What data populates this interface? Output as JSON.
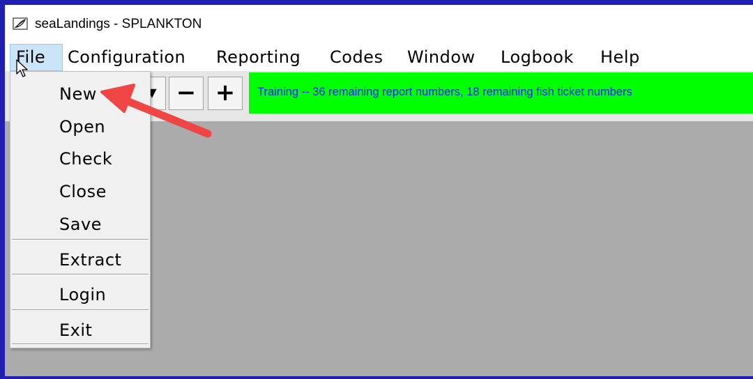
{
  "window": {
    "title": "seaLandings - SPLANKTON",
    "icon": "app-feather-icon"
  },
  "menubar": {
    "items": [
      "File",
      "Configuration",
      "Reporting",
      "Codes",
      "Window",
      "Logbook",
      "Help"
    ],
    "active": "File"
  },
  "toolbar": {
    "buttons": [
      {
        "name": "dropdown-arrow",
        "label": "▾"
      },
      {
        "name": "zoom-out",
        "label": "−"
      },
      {
        "name": "zoom-in",
        "label": "+"
      }
    ],
    "status": "Training -- 36 remaining report numbers, 18 remaining fish ticket numbers",
    "status_bg": "#00ff00",
    "status_color": "#1a1aff"
  },
  "file_menu": {
    "items": [
      "New",
      "Open",
      "Check",
      "Close",
      "Save",
      "Extract",
      "Login",
      "Exit"
    ]
  },
  "annotation": {
    "type": "red-arrow-pointing-to-new",
    "color": "#f04545"
  },
  "colors": {
    "frame": "#2020b0",
    "workspace": "#ababab",
    "menu_highlight": "#cce4f7"
  }
}
